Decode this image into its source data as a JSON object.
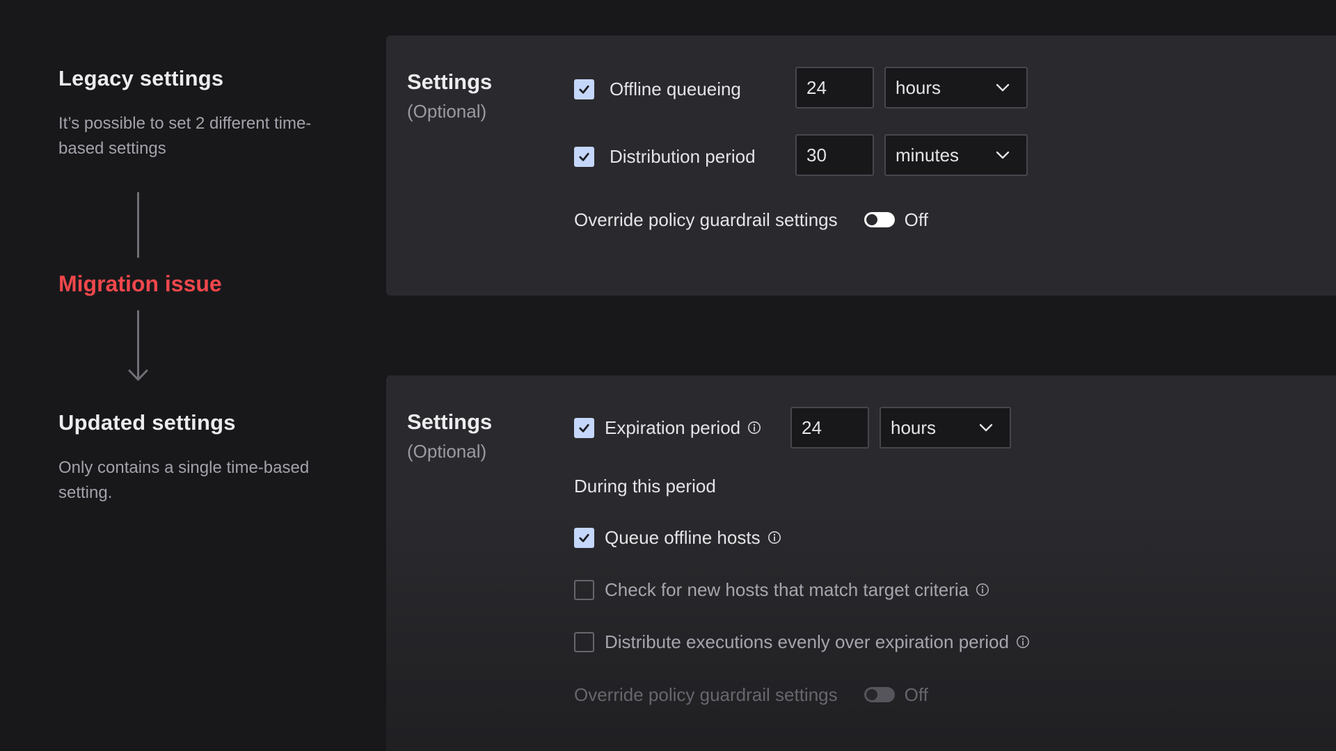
{
  "left": {
    "legacy_title": "Legacy settings",
    "legacy_desc": "It’s possible to set 2 different time-based settings",
    "migration_label": "Migration issue",
    "updated_title": "Updated settings",
    "updated_desc": "Only contains a single time-based setting."
  },
  "legacy_panel": {
    "title": "Settings",
    "subtitle": "(Optional)",
    "offline_queueing": {
      "label": "Offline queueing",
      "checked": true,
      "value": "24",
      "unit": "hours"
    },
    "distribution_period": {
      "label": "Distribution period",
      "checked": true,
      "value": "30",
      "unit": "minutes"
    },
    "override": {
      "label": "Override policy guardrail settings",
      "state": "Off"
    }
  },
  "updated_panel": {
    "title": "Settings",
    "subtitle": "(Optional)",
    "expiration_period": {
      "label": "Expiration period",
      "checked": true,
      "value": "24",
      "unit": "hours"
    },
    "during_label": "During this period",
    "queue_offline_hosts": {
      "label": "Queue offline hosts",
      "checked": true
    },
    "check_new_hosts": {
      "label": "Check for new hosts that match target criteria",
      "checked": false
    },
    "distribute_evenly": {
      "label": "Distribute executions evenly over expiration period",
      "checked": false
    },
    "override": {
      "label": "Override policy guardrail settings",
      "state": "Off"
    }
  },
  "colors": {
    "background": "#18181b",
    "panel": "#2a2a2e",
    "accent_checkbox": "#c5d7fb",
    "migration_red": "#f0474b"
  },
  "icons": {
    "check": "check-icon",
    "info": "info-icon",
    "chevron": "chevron-down-icon",
    "arrow": "arrow-down-icon"
  }
}
